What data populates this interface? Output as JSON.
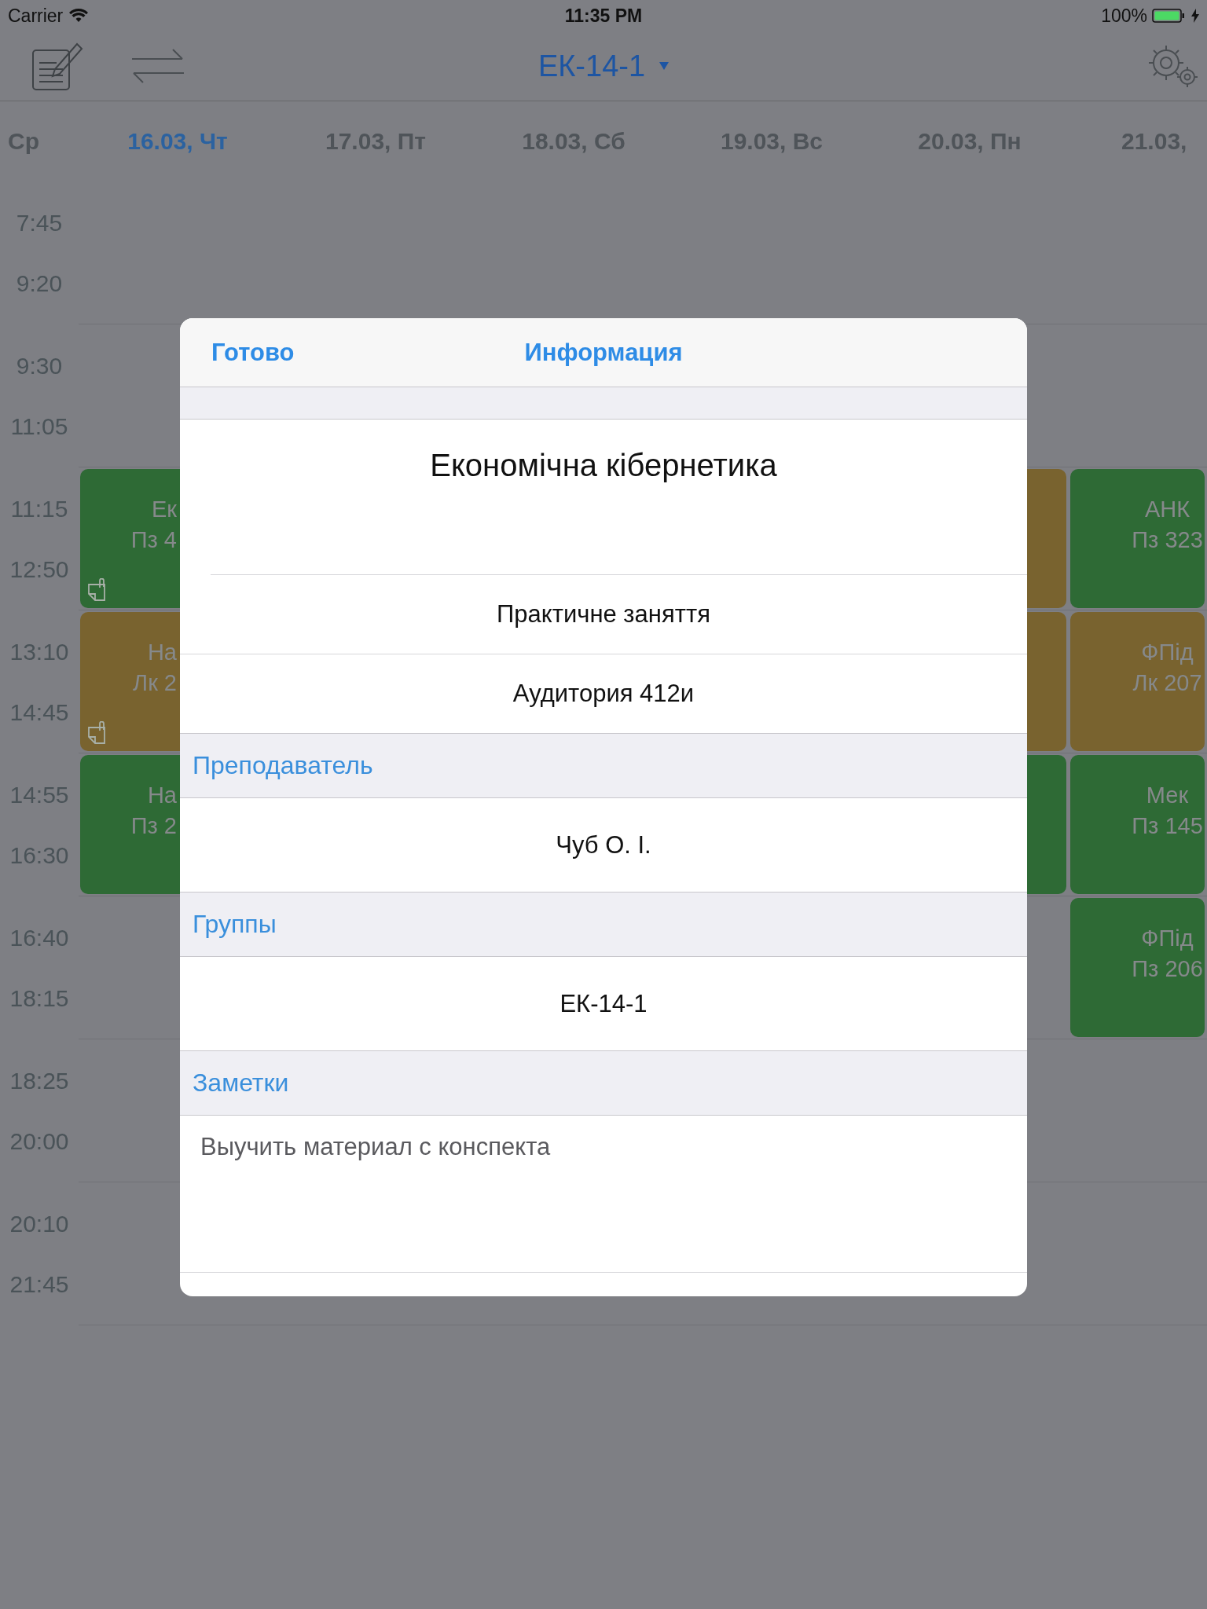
{
  "status_bar": {
    "carrier": "Carrier",
    "time": "11:35 PM",
    "battery": "100%"
  },
  "nav_bar": {
    "title": "ЕК-14-1"
  },
  "days": [
    {
      "label": "Ср",
      "selected": false
    },
    {
      "label": "16.03, Чт",
      "selected": true
    },
    {
      "label": "17.03, Пт",
      "selected": false
    },
    {
      "label": "18.03, Сб",
      "selected": false
    },
    {
      "label": "19.03, Вс",
      "selected": false
    },
    {
      "label": "20.03, Пн",
      "selected": false
    },
    {
      "label": "21.03,",
      "selected": false
    }
  ],
  "time_slots": [
    {
      "start": "7:45",
      "end": "9:20"
    },
    {
      "start": "9:30",
      "end": "11:05"
    },
    {
      "start": "11:15",
      "end": "12:50"
    },
    {
      "start": "13:10",
      "end": "14:45"
    },
    {
      "start": "14:55",
      "end": "16:30"
    },
    {
      "start": "16:40",
      "end": "18:15"
    },
    {
      "start": "18:25",
      "end": "20:00"
    },
    {
      "start": "20:10",
      "end": "21:45"
    }
  ],
  "columns": [
    {
      "cells": [
        {
          "kind": "empty"
        },
        {
          "kind": "empty"
        },
        {
          "kind": "practice",
          "lines": [
            "Ек",
            "Пз 4"
          ],
          "note": true
        },
        {
          "kind": "lecture",
          "lines": [
            "На",
            "Лк 2"
          ],
          "note": true
        },
        {
          "kind": "practice",
          "lines": [
            "На",
            "Пз 2"
          ],
          "note": false
        },
        {
          "kind": "empty"
        },
        {
          "kind": "empty"
        },
        {
          "kind": "empty"
        }
      ]
    },
    {
      "cells": [
        {
          "kind": "empty"
        },
        {
          "kind": "empty"
        },
        {
          "kind": "empty"
        },
        {
          "kind": "empty"
        },
        {
          "kind": "empty"
        },
        {
          "kind": "empty"
        },
        {
          "kind": "empty"
        },
        {
          "kind": "empty"
        }
      ]
    },
    {
      "cells": [
        {
          "kind": "empty"
        },
        {
          "kind": "empty"
        },
        {
          "kind": "empty"
        },
        {
          "kind": "empty"
        },
        {
          "kind": "empty"
        },
        {
          "kind": "empty"
        },
        {
          "kind": "empty"
        },
        {
          "kind": "empty"
        }
      ]
    },
    {
      "cells": [
        {
          "kind": "empty"
        },
        {
          "kind": "empty"
        },
        {
          "kind": "empty"
        },
        {
          "kind": "empty"
        },
        {
          "kind": "empty"
        },
        {
          "kind": "empty"
        },
        {
          "kind": "empty"
        },
        {
          "kind": "empty"
        }
      ]
    },
    {
      "cells": [
        {
          "kind": "empty"
        },
        {
          "kind": "empty"
        },
        {
          "kind": "lecture"
        },
        {
          "kind": "lecture"
        },
        {
          "kind": "practice"
        },
        {
          "kind": "empty"
        },
        {
          "kind": "empty"
        },
        {
          "kind": "empty"
        }
      ]
    },
    {
      "cells": [
        {
          "kind": "empty"
        },
        {
          "kind": "empty"
        },
        {
          "kind": "practice",
          "lines": [
            "АНК",
            "Пз 323"
          ],
          "note": false
        },
        {
          "kind": "lecture",
          "lines": [
            "ФПід",
            "Лк 207"
          ],
          "note": false
        },
        {
          "kind": "practice",
          "lines": [
            "Мек",
            "Пз 145"
          ],
          "note": false
        },
        {
          "kind": "practice",
          "lines": [
            "ФПід",
            "Пз 206"
          ],
          "note": false
        },
        {
          "kind": "empty"
        },
        {
          "kind": "empty"
        }
      ]
    }
  ],
  "dialog": {
    "done_button": "Готово",
    "title": "Информация",
    "subject": "Економічна кібернетика",
    "details": [
      "Практичне заняття",
      "Аудитория 412и"
    ],
    "sections": [
      {
        "header": "Преподаватель",
        "value": "Чуб О. І."
      },
      {
        "header": "Группы",
        "value": "ЕК-14-1"
      }
    ],
    "notes": {
      "header": "Заметки",
      "value": "Выучить материал с конспекта"
    }
  }
}
